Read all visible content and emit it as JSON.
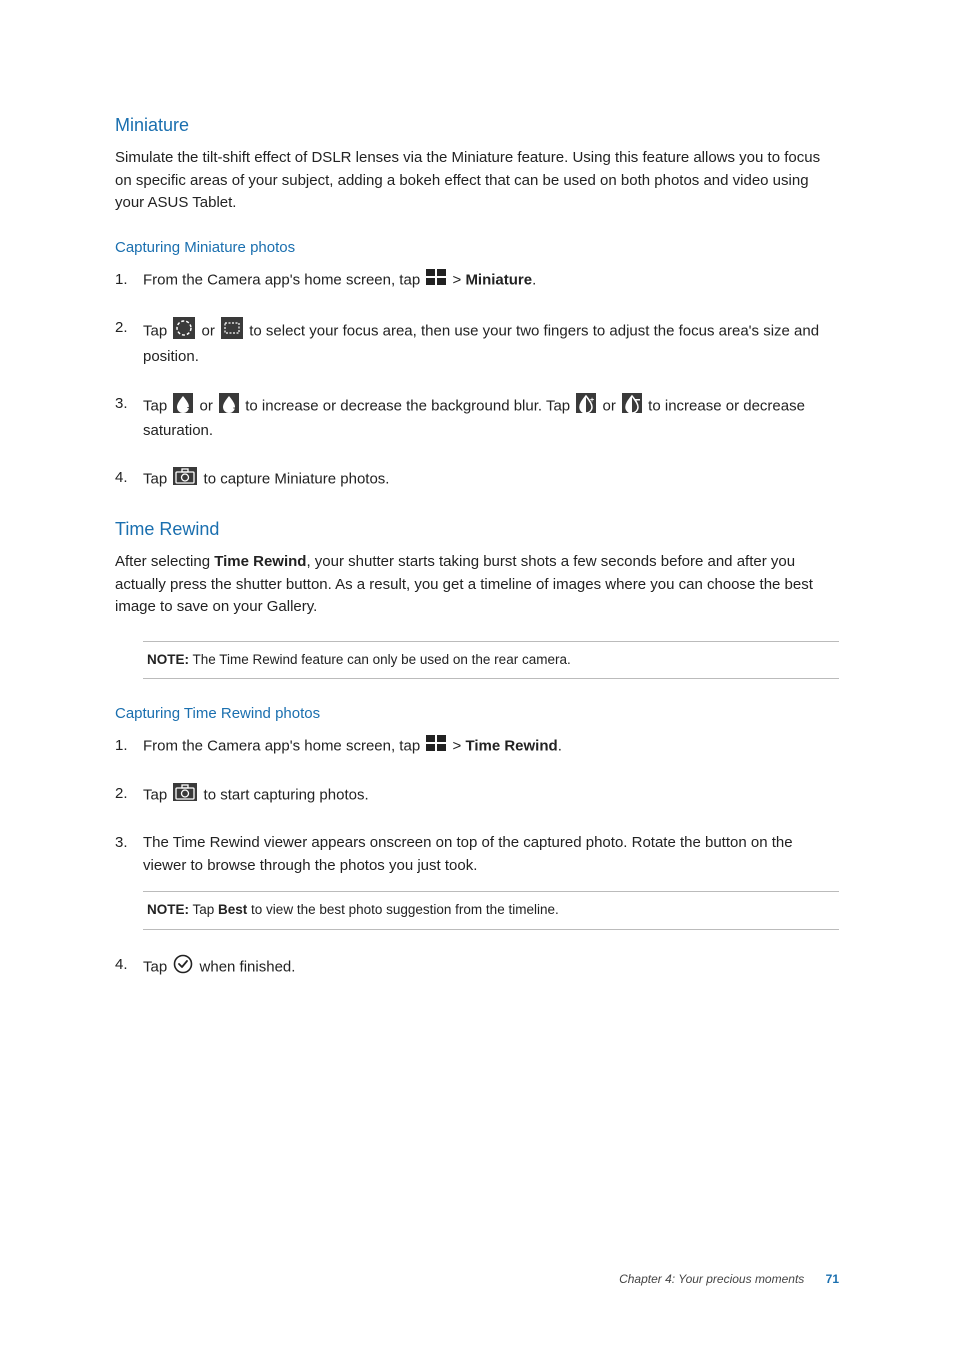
{
  "miniature": {
    "title": "Miniature",
    "desc": "Simulate the tilt-shift effect of DSLR lenses via the Miniature feature. Using this feature allows you to focus on specific areas of your subject, adding a bokeh effect that can be used on both photos and video using your ASUS Tablet.",
    "sub": "Capturing Miniature photos",
    "s1a": "From the Camera app's home screen, tap ",
    "s1b": " > ",
    "s1c": "Miniature",
    "s1d": ".",
    "s2a": "Tap ",
    "s2b": " or ",
    "s2c": " to select your focus area, then use your two fingers to adjust the focus area's size and position.",
    "s3a": "Tap ",
    "s3b": " or ",
    "s3c": " to increase or decrease the background blur. Tap ",
    "s3d": " or ",
    "s3e": " to increase or decrease saturation.",
    "s4a": "Tap ",
    "s4b": " to capture Miniature photos."
  },
  "timerewind": {
    "title": "Time Rewind",
    "desc_a": "After selecting ",
    "desc_b": "Time Rewind",
    "desc_c": ", your shutter starts taking burst shots a few seconds before and after you actually press the shutter button. As a result, you get a timeline of images where you can choose the best image to save on your Gallery.",
    "note1_label": "NOTE:",
    "note1": " The Time Rewind feature can only be used on the rear camera.",
    "sub": "Capturing Time Rewind photos",
    "s1a": "From the Camera app's home screen, tap ",
    "s1b": " > ",
    "s1c": "Time Rewind",
    "s1d": ".",
    "s2a": "Tap ",
    "s2b": " to start capturing photos.",
    "s3": "The Time Rewind viewer appears onscreen on top of the captured photo. Rotate the button on the viewer to browse through the photos you just took.",
    "note2_label": "NOTE:",
    "note2a": " Tap ",
    "note2b": "Best",
    "note2c": " to view the best photo suggestion from the timeline.",
    "s4a": "Tap ",
    "s4b": " when finished."
  },
  "footer": {
    "chapter": "Chapter 4: Your precious moments",
    "page": "71"
  }
}
